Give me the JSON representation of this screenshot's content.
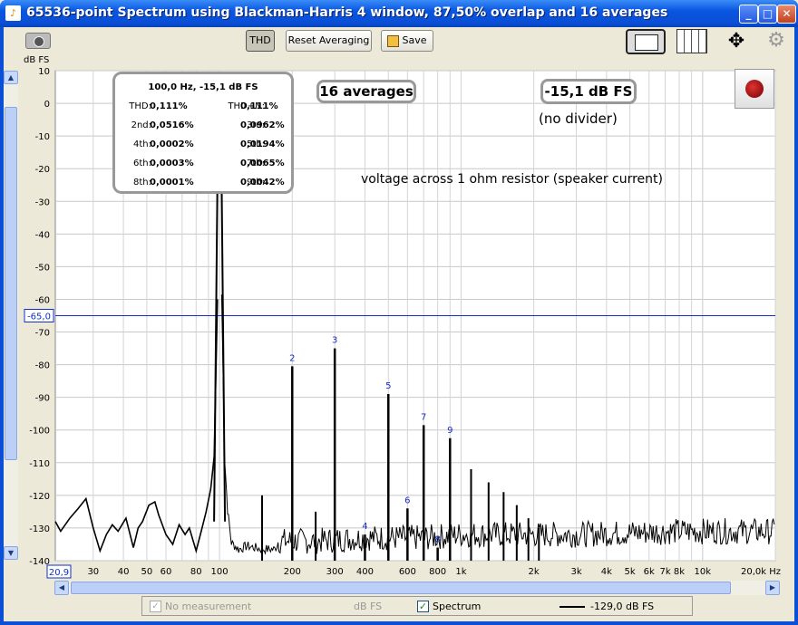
{
  "window": {
    "title": "65536-point Spectrum using Blackman-Harris 4 window, 87,50% overlap and 16 averages",
    "minimize": "_",
    "maximize": "□",
    "close": "✕"
  },
  "toolbar": {
    "thd": "THD",
    "reset": "Reset Averaging",
    "save": "Save"
  },
  "y_unit": "dB FS",
  "readout": {
    "header": "100,0 Hz, -15,1 dB FS",
    "rows": [
      {
        "k1": "THD:",
        "v1": "0,111%",
        "k2": "THD+N:",
        "v2": "0,111%"
      },
      {
        "k1": "2nd:",
        "v1": "0,0516%",
        "k2": "3rd:",
        "v2": "0,0962%"
      },
      {
        "k1": "4th:",
        "v1": "0,0002%",
        "k2": "5th:",
        "v2": "0,0194%"
      },
      {
        "k1": "6th:",
        "v1": "0,0003%",
        "k2": "7th:",
        "v2": "0,0065%"
      },
      {
        "k1": "8th:",
        "v1": "0,0001%",
        "k2": "9th:",
        "v2": "0,0042%"
      }
    ]
  },
  "averages_badge": "16 averages",
  "level_badge": "-15,1 dB FS",
  "divider_note": "(no divider)",
  "annotation": "voltage across 1 ohm resistor (speaker current)",
  "cursor_value": "-65,0",
  "x_start_box": "20,9",
  "legend": {
    "no_measurement": "No measurement",
    "unit": "dB FS",
    "spectrum": "Spectrum",
    "line_label": "-129,0 dB FS",
    "no_measurement_checked": true,
    "spectrum_checked": true
  },
  "chart_data": {
    "type": "line",
    "x_scale": "log",
    "xlim": [
      20.9,
      20000
    ],
    "ylim": [
      -140,
      10
    ],
    "yticks": [
      10,
      0,
      -10,
      -20,
      -30,
      -40,
      -50,
      -60,
      -70,
      -80,
      -90,
      -100,
      -110,
      -120,
      -130,
      -140
    ],
    "xticks": [
      {
        "v": 20.9,
        "l": ""
      },
      {
        "v": 30,
        "l": "30"
      },
      {
        "v": 40,
        "l": "40"
      },
      {
        "v": 50,
        "l": "50"
      },
      {
        "v": 60,
        "l": "60"
      },
      {
        "v": 80,
        "l": "80"
      },
      {
        "v": 100,
        "l": "100"
      },
      {
        "v": 200,
        "l": "200"
      },
      {
        "v": 300,
        "l": "300"
      },
      {
        "v": 400,
        "l": "400"
      },
      {
        "v": 600,
        "l": "600"
      },
      {
        "v": 800,
        "l": "800"
      },
      {
        "v": 1000,
        "l": "1k"
      },
      {
        "v": 2000,
        "l": "2k"
      },
      {
        "v": 3000,
        "l": "3k"
      },
      {
        "v": 4000,
        "l": "4k"
      },
      {
        "v": 5000,
        "l": "5k"
      },
      {
        "v": 6000,
        "l": "6k"
      },
      {
        "v": 7000,
        "l": "7k"
      },
      {
        "v": 8000,
        "l": "8k"
      },
      {
        "v": 10000,
        "l": "10k"
      },
      {
        "v": 20000,
        "l": "20,0k Hz"
      }
    ],
    "cursor_db": -65,
    "fundamental": {
      "f": 100,
      "db": -15.1
    },
    "harmonics": [
      {
        "n": "2",
        "f": 200,
        "db": -80.5
      },
      {
        "n": "3",
        "f": 300,
        "db": -75
      },
      {
        "n": "4",
        "f": 400,
        "db": -132
      },
      {
        "n": "5",
        "f": 500,
        "db": -89
      },
      {
        "n": "6",
        "f": 600,
        "db": -124
      },
      {
        "n": "7",
        "f": 700,
        "db": -98.5
      },
      {
        "n": "8",
        "f": 800,
        "db": -136
      },
      {
        "n": "9",
        "f": 900,
        "db": -102.5
      }
    ],
    "spurs": [
      {
        "f": 150,
        "db": -120
      },
      {
        "f": 250,
        "db": -125
      },
      {
        "f": 1100,
        "db": -112
      },
      {
        "f": 1300,
        "db": -116
      },
      {
        "f": 1500,
        "db": -119
      },
      {
        "f": 1700,
        "db": -123
      },
      {
        "f": 1900,
        "db": -127
      },
      {
        "f": 2100,
        "db": -130
      }
    ],
    "noise_low": [
      [
        20.9,
        -128
      ],
      [
        22,
        -131
      ],
      [
        24,
        -127
      ],
      [
        26,
        -124
      ],
      [
        28,
        -121
      ],
      [
        30,
        -130
      ],
      [
        32,
        -137
      ],
      [
        34,
        -132
      ],
      [
        36,
        -129
      ],
      [
        38,
        -131
      ],
      [
        41,
        -127
      ],
      [
        44,
        -136
      ],
      [
        46,
        -130
      ],
      [
        48,
        -128
      ],
      [
        51,
        -123
      ],
      [
        54,
        -122
      ],
      [
        56,
        -126
      ],
      [
        60,
        -132
      ],
      [
        64,
        -135
      ],
      [
        68,
        -129
      ],
      [
        72,
        -132
      ],
      [
        75,
        -130
      ],
      [
        80,
        -137
      ],
      [
        84,
        -131
      ],
      [
        88,
        -125
      ],
      [
        92,
        -118
      ],
      [
        95,
        -108
      ],
      [
        98,
        -60
      ]
    ],
    "noise_high": [
      [
        102,
        -60
      ],
      [
        105,
        -110
      ],
      [
        108,
        -126
      ],
      [
        112,
        -136
      ],
      [
        120,
        -138
      ],
      [
        130,
        -137
      ],
      [
        150,
        -138
      ],
      [
        180,
        -138
      ],
      [
        250,
        -138
      ],
      [
        400,
        -137
      ],
      [
        700,
        -137
      ],
      [
        1000,
        -136
      ],
      [
        3000,
        -136
      ],
      [
        8000,
        -135
      ],
      [
        20000,
        -135
      ]
    ]
  }
}
